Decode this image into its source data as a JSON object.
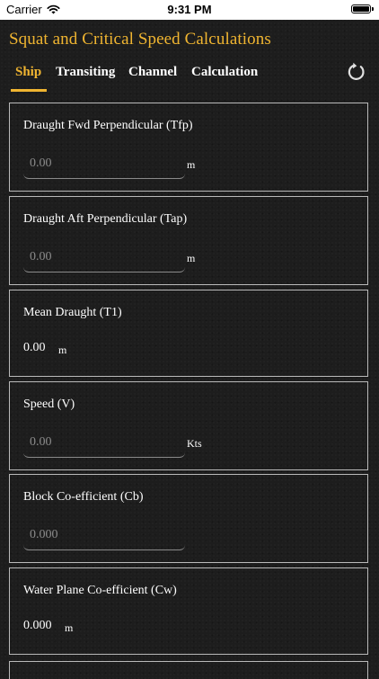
{
  "status_bar": {
    "carrier": "Carrier",
    "time": "9:31 PM"
  },
  "app": {
    "title": "Squat and Critical Speed Calculations"
  },
  "tabs": [
    {
      "label": "Ship",
      "active": true
    },
    {
      "label": "Transiting",
      "active": false
    },
    {
      "label": "Channel",
      "active": false
    },
    {
      "label": "Calculation",
      "active": false
    }
  ],
  "icons": {
    "refresh": "refresh-icon",
    "wifi": "wifi-icon",
    "battery": "battery-icon"
  },
  "colors": {
    "accent": "#f0b531",
    "background": "#1d1d1d",
    "card_border": "#b9b9b9"
  },
  "fields": {
    "tfp": {
      "label": "Draught Fwd Perpendicular (Tfp)",
      "placeholder": "0.00",
      "unit": "m"
    },
    "tap": {
      "label": "Draught Aft Perpendicular (Tap)",
      "placeholder": "0.00",
      "unit": "m"
    },
    "t1": {
      "label": "Mean Draught (T1)",
      "value": "0.00",
      "unit": "m"
    },
    "speed": {
      "label": "Speed (V)",
      "placeholder": "0.00",
      "unit": "Kts"
    },
    "cb": {
      "label": "Block Co-efficient (Cb)",
      "placeholder": "0.000"
    },
    "cw": {
      "label": "Water Plane Co-efficient (Cw)",
      "value": "0.000",
      "unit": "m"
    }
  }
}
